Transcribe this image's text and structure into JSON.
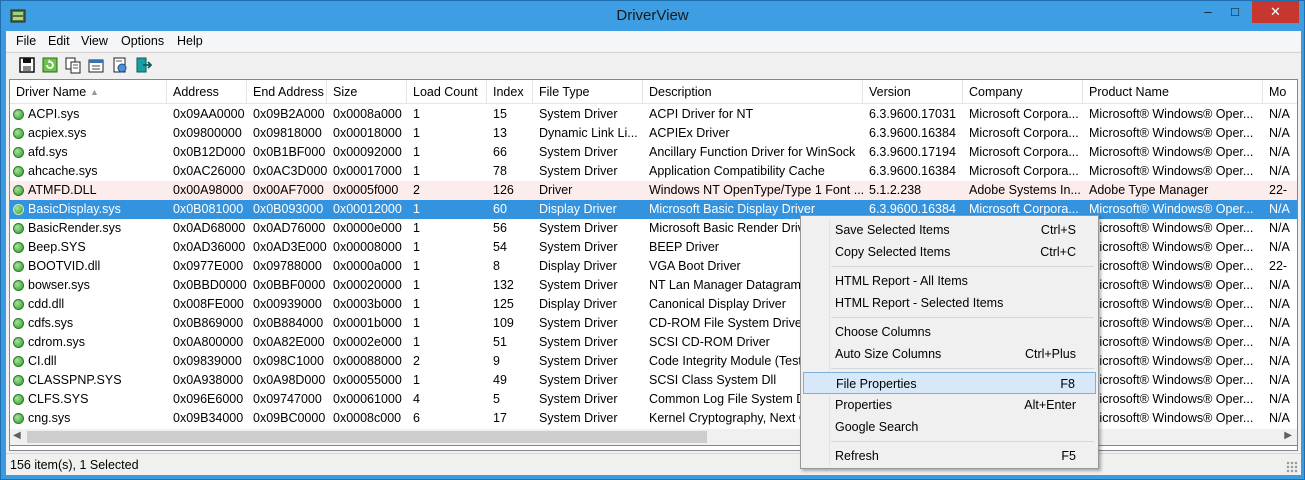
{
  "window": {
    "title": "DriverView",
    "minimize": "–",
    "maximize": "□",
    "close": "✕"
  },
  "menu": [
    "File",
    "Edit",
    "View",
    "Options",
    "Help"
  ],
  "toolbar": [
    "save-icon",
    "refresh-icon",
    "copy-icon",
    "properties-icon",
    "html-report-icon",
    "exit-icon"
  ],
  "columns": [
    "Driver Name",
    "Address",
    "End Address",
    "Size",
    "Load Count",
    "Index",
    "File Type",
    "Description",
    "Version",
    "Company",
    "Product Name",
    "Mo"
  ],
  "rows": [
    [
      "ACPI.sys",
      "0x09AA0000",
      "0x09B2A000",
      "0x0008a000",
      "1",
      "15",
      "System Driver",
      "ACPI Driver for NT",
      "6.3.9600.17031",
      "Microsoft Corpora...",
      "Microsoft® Windows® Oper...",
      "N/A"
    ],
    [
      "acpiex.sys",
      "0x09800000",
      "0x09818000",
      "0x00018000",
      "1",
      "13",
      "Dynamic Link Li...",
      "ACPIEx Driver",
      "6.3.9600.16384",
      "Microsoft Corpora...",
      "Microsoft® Windows® Oper...",
      "N/A"
    ],
    [
      "afd.sys",
      "0x0B12D000",
      "0x0B1BF000",
      "0x00092000",
      "1",
      "66",
      "System Driver",
      "Ancillary Function Driver for WinSock",
      "6.3.9600.17194",
      "Microsoft Corpora...",
      "Microsoft® Windows® Oper...",
      "N/A"
    ],
    [
      "ahcache.sys",
      "0x0AC26000",
      "0x0AC3D000",
      "0x00017000",
      "1",
      "78",
      "System Driver",
      "Application Compatibility Cache",
      "6.3.9600.16384",
      "Microsoft Corpora...",
      "Microsoft® Windows® Oper...",
      "N/A"
    ],
    [
      "ATMFD.DLL",
      "0x00A98000",
      "0x00AF7000",
      "0x0005f000",
      "2",
      "126",
      "Driver",
      "Windows NT OpenType/Type 1 Font ...",
      "5.1.2.238",
      "Adobe Systems In...",
      "Adobe Type Manager",
      "22-"
    ],
    [
      "BasicDisplay.sys",
      "0x0B081000",
      "0x0B093000",
      "0x00012000",
      "1",
      "60",
      "Display Driver",
      "Microsoft Basic Display Driver",
      "6.3.9600.16384",
      "Microsoft Corpora...",
      "Microsoft® Windows® Oper...",
      "N/A"
    ],
    [
      "BasicRender.sys",
      "0x0AD68000",
      "0x0AD76000",
      "0x0000e000",
      "1",
      "56",
      "System Driver",
      "Microsoft Basic Render Driver",
      "",
      "",
      "Microsoft® Windows® Oper...",
      "N/A"
    ],
    [
      "Beep.SYS",
      "0x0AD36000",
      "0x0AD3E000",
      "0x00008000",
      "1",
      "54",
      "System Driver",
      "BEEP Driver",
      "",
      "",
      "Microsoft® Windows® Oper...",
      "N/A"
    ],
    [
      "BOOTVID.dll",
      "0x0977E000",
      "0x09788000",
      "0x0000a000",
      "1",
      "8",
      "Display Driver",
      "VGA Boot Driver",
      "",
      "",
      "Microsoft® Windows® Oper...",
      "22-"
    ],
    [
      "bowser.sys",
      "0x0BBD0000",
      "0x0BBF0000",
      "0x00020000",
      "1",
      "132",
      "System Driver",
      "NT Lan Manager Datagram Re",
      "",
      "",
      "Microsoft® Windows® Oper...",
      "N/A"
    ],
    [
      "cdd.dll",
      "0x008FE000",
      "0x00939000",
      "0x0003b000",
      "1",
      "125",
      "Display Driver",
      "Canonical Display Driver",
      "",
      "",
      "Microsoft® Windows® Oper...",
      "N/A"
    ],
    [
      "cdfs.sys",
      "0x0B869000",
      "0x0B884000",
      "0x0001b000",
      "1",
      "109",
      "System Driver",
      "CD-ROM File System Driver",
      "",
      "",
      "Microsoft® Windows® Oper...",
      "N/A"
    ],
    [
      "cdrom.sys",
      "0x0A800000",
      "0x0A82E000",
      "0x0002e000",
      "1",
      "51",
      "System Driver",
      "SCSI CD-ROM Driver",
      "",
      "",
      "Microsoft® Windows® Oper...",
      "N/A"
    ],
    [
      "CI.dll",
      "0x09839000",
      "0x098C1000",
      "0x00088000",
      "2",
      "9",
      "System Driver",
      "Code Integrity Module (Test)",
      "",
      "",
      "Microsoft® Windows® Oper...",
      "N/A"
    ],
    [
      "CLASSPNP.SYS",
      "0x0A938000",
      "0x0A98D000",
      "0x00055000",
      "1",
      "49",
      "System Driver",
      "SCSI Class System Dll",
      "",
      "",
      "Microsoft® Windows® Oper...",
      "N/A"
    ],
    [
      "CLFS.SYS",
      "0x096E6000",
      "0x09747000",
      "0x00061000",
      "4",
      "5",
      "System Driver",
      "Common Log File System Driv",
      "",
      "",
      "Microsoft® Windows® Oper...",
      "N/A"
    ],
    [
      "cng.sys",
      "0x09B34000",
      "0x09BC0000",
      "0x0008c000",
      "6",
      "17",
      "System Driver",
      "Kernel Cryptography, Next Ger",
      "",
      "",
      "Microsoft® Windows® Oper...",
      "N/A"
    ]
  ],
  "status": "156 item(s), 1 Selected",
  "context_menu": [
    {
      "label": "Save Selected Items",
      "key": "Ctrl+S"
    },
    {
      "label": "Copy Selected Items",
      "key": "Ctrl+C"
    },
    {
      "sep": true
    },
    {
      "label": "HTML Report - All Items",
      "key": ""
    },
    {
      "label": "HTML Report - Selected Items",
      "key": ""
    },
    {
      "sep": true
    },
    {
      "label": "Choose Columns",
      "key": ""
    },
    {
      "label": "Auto Size Columns",
      "key": "Ctrl+Plus"
    },
    {
      "sep": true
    },
    {
      "label": "File Properties",
      "key": "F8",
      "highlight": true
    },
    {
      "label": "Properties",
      "key": "Alt+Enter"
    },
    {
      "label": "Google Search",
      "key": ""
    },
    {
      "sep": true
    },
    {
      "label": "Refresh",
      "key": "F5"
    }
  ],
  "colors": {
    "selection": "#3393df",
    "pink_row": "#fdecec",
    "title_bar": "#3d9ee3",
    "close_button": "#c7372f"
  }
}
